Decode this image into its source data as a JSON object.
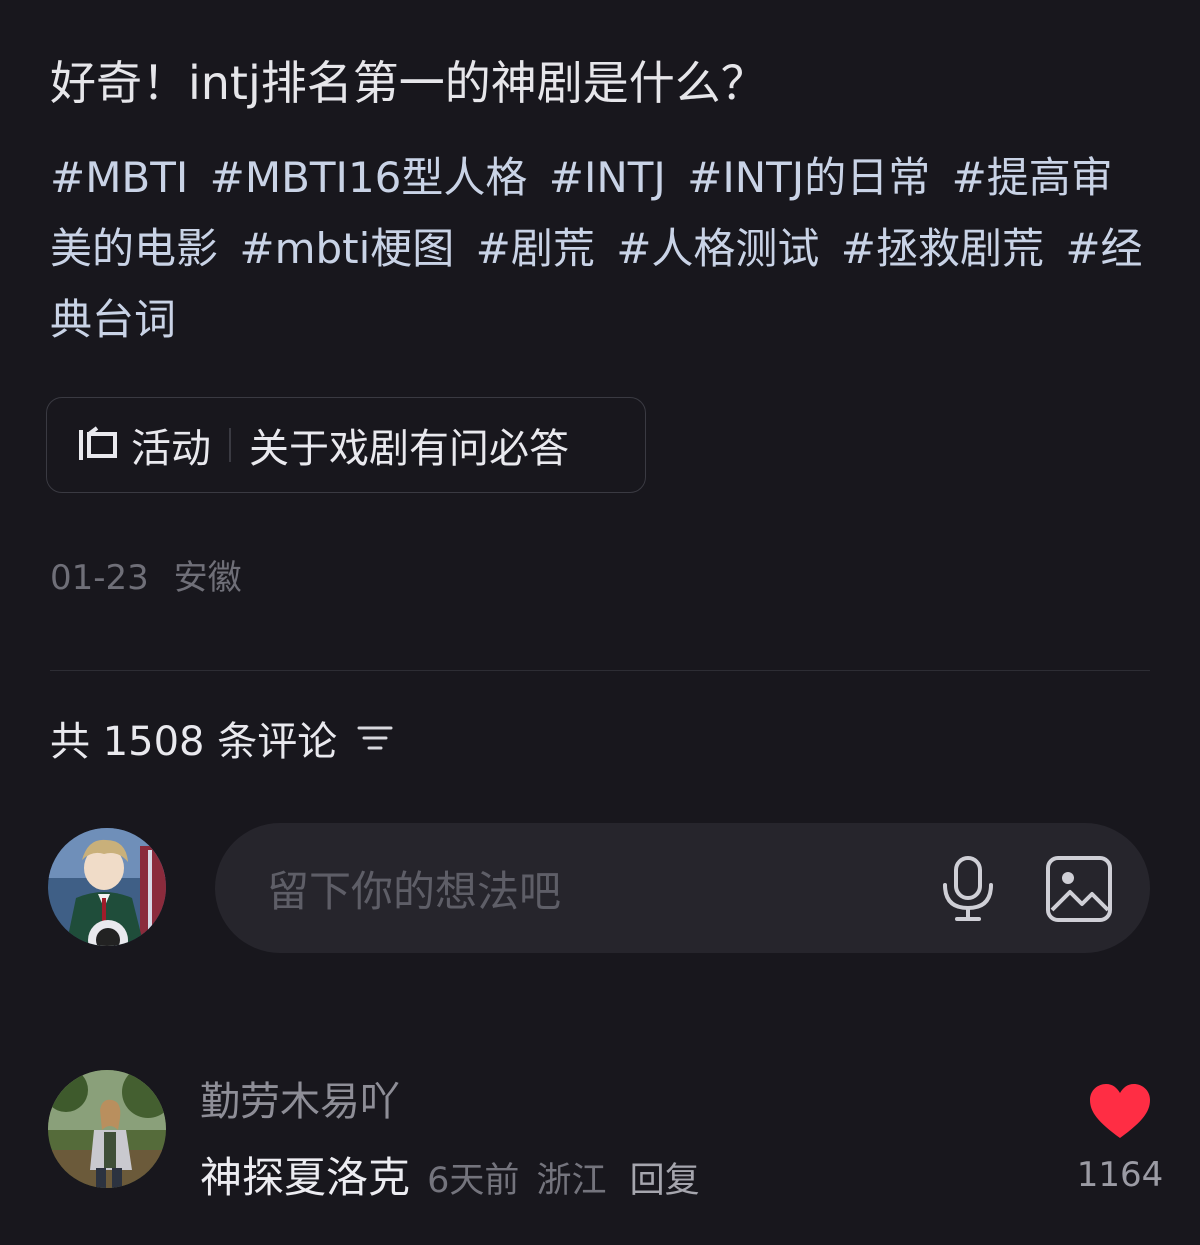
{
  "post": {
    "title": "好奇！intj排名第一的神剧是什么？",
    "tags": [
      "#MBTI",
      "#MBTI16型人格",
      "#INTJ",
      "#INTJ的日常",
      "#提高审美的电影",
      "#mbti梗图",
      "#剧荒",
      "#人格测试",
      "#拯救剧荒",
      "#经典台词"
    ],
    "activity": {
      "icon": "activity-icon",
      "label": "活动",
      "topic": "关于戏剧有问必答"
    },
    "date": "01-23",
    "location": "安徽"
  },
  "comments_header": {
    "count_text": "共 1508 条评论",
    "sort_icon": "sort-icon"
  },
  "composer": {
    "placeholder": "留下你的想法吧",
    "mic_icon": "microphone-icon",
    "image_icon": "image-icon"
  },
  "comments": [
    {
      "username": "勤劳木易吖",
      "text": "神探夏洛克",
      "time": "6天前",
      "location": "浙江",
      "reply_label": "回复",
      "likes": "1164",
      "liked": true
    }
  ],
  "colors": {
    "background": "#18171d",
    "tag": "#c9d3e6",
    "like_red": "#ff2d44"
  }
}
